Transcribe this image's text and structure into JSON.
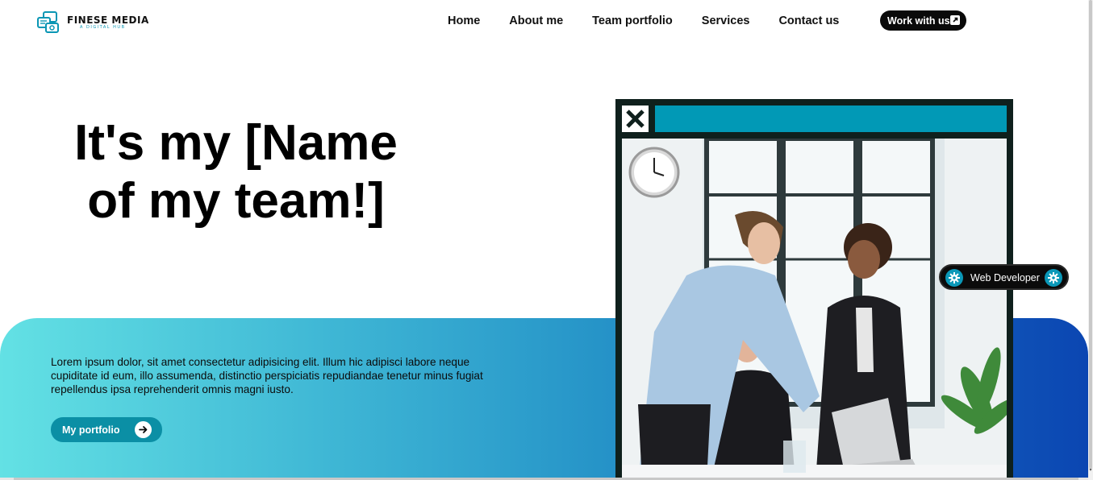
{
  "brand": {
    "name": "FINESE MEDIA",
    "tagline": "A DIGITAL HUB",
    "logo_icon": "chat-bubbles-icon"
  },
  "nav": {
    "items": [
      {
        "label": "Home"
      },
      {
        "label": "About me"
      },
      {
        "label": "Team portfolio"
      },
      {
        "label": "Services"
      },
      {
        "label": "Contact us"
      }
    ],
    "cta_label": "Work with us",
    "cta_icon": "external-link-icon"
  },
  "hero": {
    "title_line1": "It's my [Name",
    "title_line2": "of my team!]",
    "description": "Lorem ipsum dolor, sit amet consectetur adipisicing elit. Illum hic adipisci labore neque cupiditate id eum, illo assumenda, distinctio perspiciatis repudiandae tenetur minus fugiat repellendus ipsa reprehenderit omnis magni iusto.",
    "button_label": "My portfolio",
    "button_icon": "arrow-right-icon"
  },
  "window": {
    "close_icon": "close-x-icon",
    "photo_subject": "office-team-photo"
  },
  "badge": {
    "label": "Web Developer",
    "icon": "gear-icon"
  },
  "colors": {
    "accent": "#0199b6",
    "button": "#0b8fa5",
    "gradient_start": "#63e1e4",
    "gradient_end": "#0b46b2",
    "frame": "#0f201d",
    "dark": "#0a0a0a"
  }
}
